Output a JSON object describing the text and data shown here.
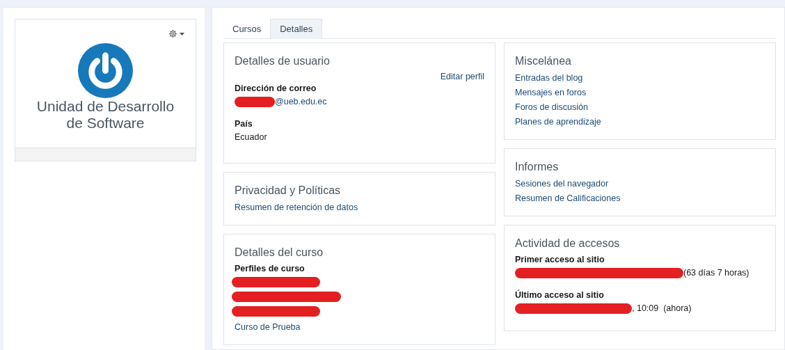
{
  "site_card": {
    "title": "Unidad de Desarrollo de Software"
  },
  "tabs": [
    {
      "label": "Cursos",
      "selected": false
    },
    {
      "label": "Detalles",
      "selected": true
    }
  ],
  "left_column": [
    {
      "title": "Detalles de usuario",
      "action": "Editar perfil",
      "fields": [
        {
          "label": "Dirección de correo",
          "value": "@ueb.edu.ec",
          "redacted_prefix": true,
          "kind": "link"
        },
        {
          "label": "País",
          "value": "Ecuador",
          "redacted_prefix": false,
          "kind": "text"
        }
      ]
    },
    {
      "title": "Privacidad y Políticas",
      "links": [
        "Resumen de retención de datos"
      ]
    },
    {
      "title": "Detalles del curso",
      "fields": [
        {
          "label": "Perfiles de curso",
          "items": [
            {
              "kind": "redacted"
            },
            {
              "kind": "redacted"
            },
            {
              "kind": "redacted"
            },
            {
              "kind": "link",
              "text": "Curso de Prueba"
            }
          ]
        }
      ]
    }
  ],
  "right_column": [
    {
      "title": "Miscelánea",
      "links": [
        "Entradas del blog",
        "Mensajes en foros",
        "Foros de discusión",
        "Planes de aprendizaje"
      ]
    },
    {
      "title": "Informes",
      "links": [
        "Sesiones del navegador",
        "Resumen de Calificaciones"
      ]
    },
    {
      "title": "Actividad de accesos",
      "fields": [
        {
          "label": "Primer acceso al sitio",
          "value": "(63 días 7 horas)",
          "redacted_prefix": true,
          "kind": "text"
        },
        {
          "label": "Último acceso al sitio",
          "value": ", 10:09  (ahora)",
          "redacted_prefix": true,
          "kind": "text"
        }
      ]
    }
  ]
}
